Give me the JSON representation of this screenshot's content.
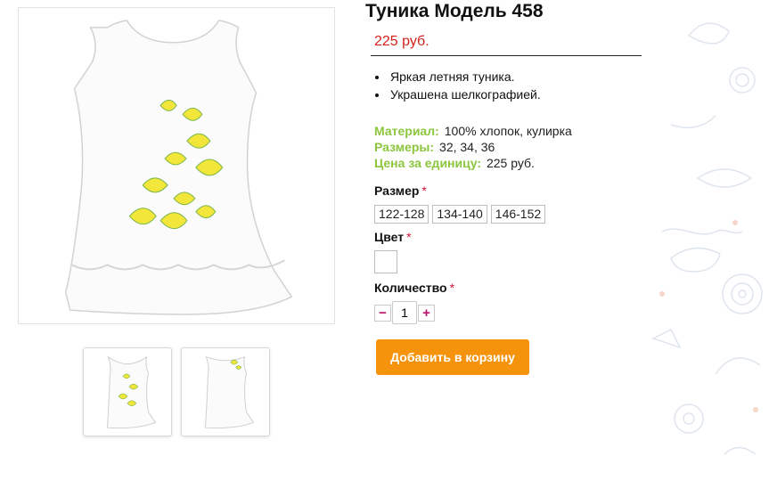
{
  "product": {
    "title": "Туника Модель 458",
    "price": "225 руб.",
    "features": [
      "Яркая летняя туника.",
      "Украшена шелкографией."
    ],
    "specs": [
      {
        "label": "Материал:",
        "value": "100% хлопок, кулирка"
      },
      {
        "label": "Размеры:",
        "value": "32, 34, 36"
      },
      {
        "label": "Цена за единицу:",
        "value": "225 руб."
      }
    ]
  },
  "options": {
    "size_label": "Размер",
    "required_mark": "*",
    "sizes": [
      "122-128",
      "134-140",
      "146-152"
    ],
    "color_label": "Цвет",
    "color_value": "#ffffff",
    "quantity_label": "Количество",
    "quantity_value": "1",
    "minus": "−",
    "plus": "+"
  },
  "cart": {
    "add_label": "Добавить в корзину"
  },
  "colors": {
    "accent": "#f5940c",
    "price": "#d4201b",
    "spec_label": "#8cc63f",
    "required": "#d0143a"
  },
  "icons": {
    "main_image": "tunic-front-image",
    "thumb1": "tunic-front-thumb",
    "thumb2": "tunic-back-thumb"
  }
}
